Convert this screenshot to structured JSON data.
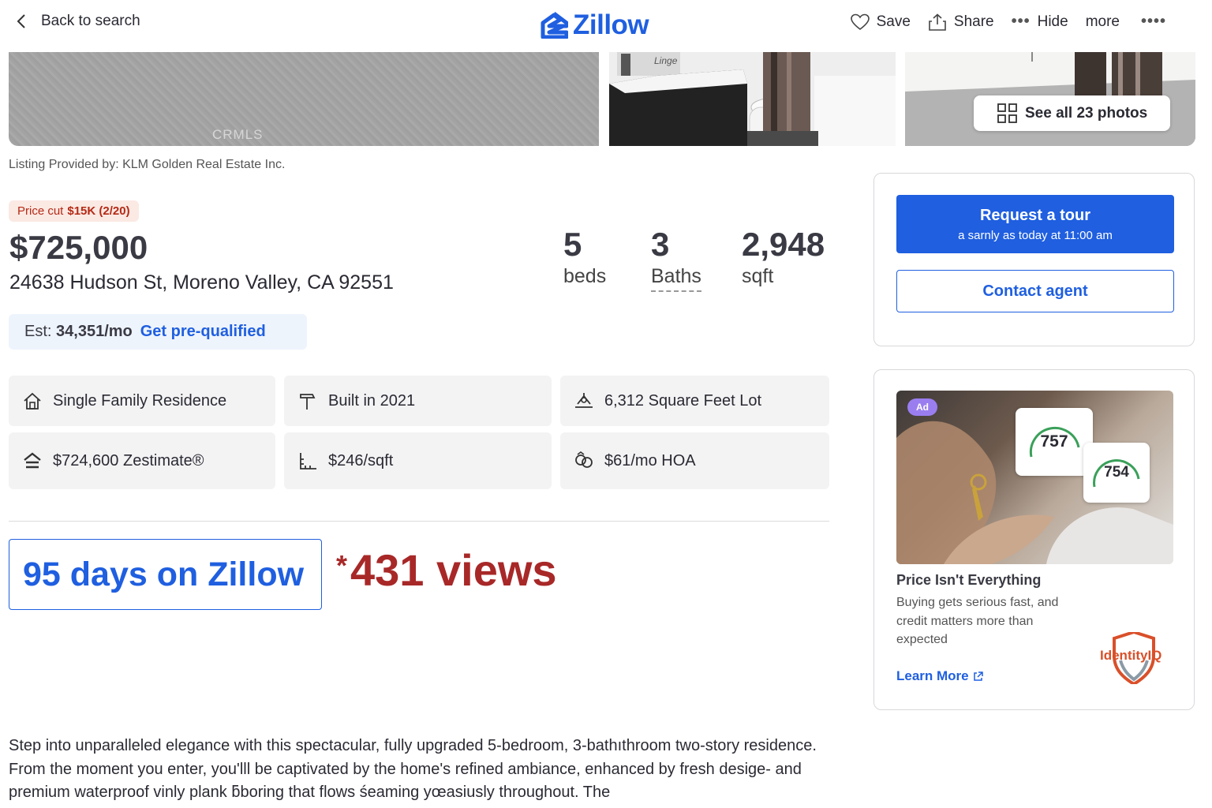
{
  "header": {
    "back_label": "Back to search",
    "logo_text": "Zillow",
    "save_label": "Save",
    "share_label": "Share",
    "hide_label": "Hide",
    "more_label": "more",
    "brand_color": "#1f5fe0"
  },
  "photos": {
    "watermark": "CRMLS",
    "see_all_label": "See all 23 photos"
  },
  "listing": {
    "provided_by": "Listing Provided by: KLM Golden Real Estate Inc.",
    "price_cut_label": "Price cut",
    "price_cut_value": "$15K (2/20)",
    "price": "$725,000",
    "address": "24638 Hudson St, Moreno Valley, CA 92551",
    "beds_value": "5",
    "beds_label": "beds",
    "baths_value": "3",
    "baths_label": "Baths",
    "sqft_value": "2,948",
    "sqft_label": "sqft",
    "est_label": "Est:",
    "est_value": "34,351/mo",
    "prequal_label": "Get pre-qualified"
  },
  "facts": [
    {
      "icon": "house-icon",
      "label": "Single Family Residence"
    },
    {
      "icon": "hammer-icon",
      "label": "Built in 2021"
    },
    {
      "icon": "lot-icon",
      "label": "6,312 Square Feet Lot"
    },
    {
      "icon": "zestimate-icon",
      "label": "$724,600 Zestimate®"
    },
    {
      "icon": "ruler-icon",
      "label": "$246/sqft"
    },
    {
      "icon": "hoa-icon",
      "label": "$61/mo HOA"
    }
  ],
  "stats": {
    "days_on_zillow": "95 days on Zillow",
    "views_star": "*",
    "views": "431 views"
  },
  "description": "Step into unparalleled elegance with this spectacular, fully upgraded 5-bedroom, 3-bathıthroom two-story residence. From the moment you enter, you'lll be captivated by the home's refined ambiance, enhanced by fresh desige‑ and premium waterproof vinly plank ƃboring that flows śeaming yœasiusly throughout. The",
  "sidebar": {
    "tour_label": "Request a tour",
    "tour_sub": "a sarnly as today at 11:00 am",
    "contact_label": "Contact agent",
    "ad_tag": "Ad",
    "score_1": "757",
    "score_2": "754",
    "ad_title": "Price Isn't Everything",
    "ad_text": "Buying gets serious fast, and credit matters more than expected",
    "learn_more": "Learn More",
    "brand_name": "IdentityIQ"
  }
}
